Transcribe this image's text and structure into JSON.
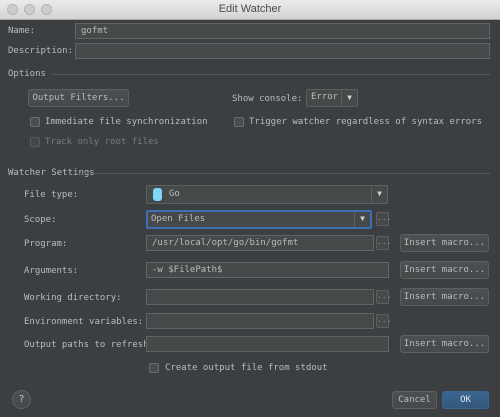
{
  "window": {
    "title": "Edit Watcher"
  },
  "name": {
    "label": "Name:",
    "value": "gofmt"
  },
  "description": {
    "label": "Description:",
    "value": ""
  },
  "options": {
    "section_label": "Options",
    "output_filters_button": "Output Filters...",
    "show_console_label": "Show console:",
    "show_console_value": "Error",
    "immediate_sync_label": "Immediate file synchronization",
    "trigger_label": "Trigger watcher regardless of syntax errors",
    "track_root_label": "Track only root files"
  },
  "watcher": {
    "section_label": "Watcher Settings",
    "file_type_label": "File type:",
    "file_type_value": "Go",
    "scope_label": "Scope:",
    "scope_value": "Open Files",
    "program_label": "Program:",
    "program_value": "/usr/local/opt/go/bin/gofmt",
    "arguments_label": "Arguments:",
    "arguments_value": "-w $FilePath$",
    "working_dir_label": "Working directory:",
    "working_dir_value": "",
    "env_label": "Environment variables:",
    "env_value": "",
    "output_paths_label": "Output paths to refresh:",
    "output_paths_value": "",
    "insert_macro": "Insert macro...",
    "create_output_label": "Create output file from stdout",
    "ellipsis": "..."
  },
  "footer": {
    "help": "?",
    "cancel": "Cancel",
    "ok": "OK"
  },
  "colors": {
    "background": "#3c3f41",
    "accent": "#365880",
    "focus": "#3d6fb5"
  }
}
